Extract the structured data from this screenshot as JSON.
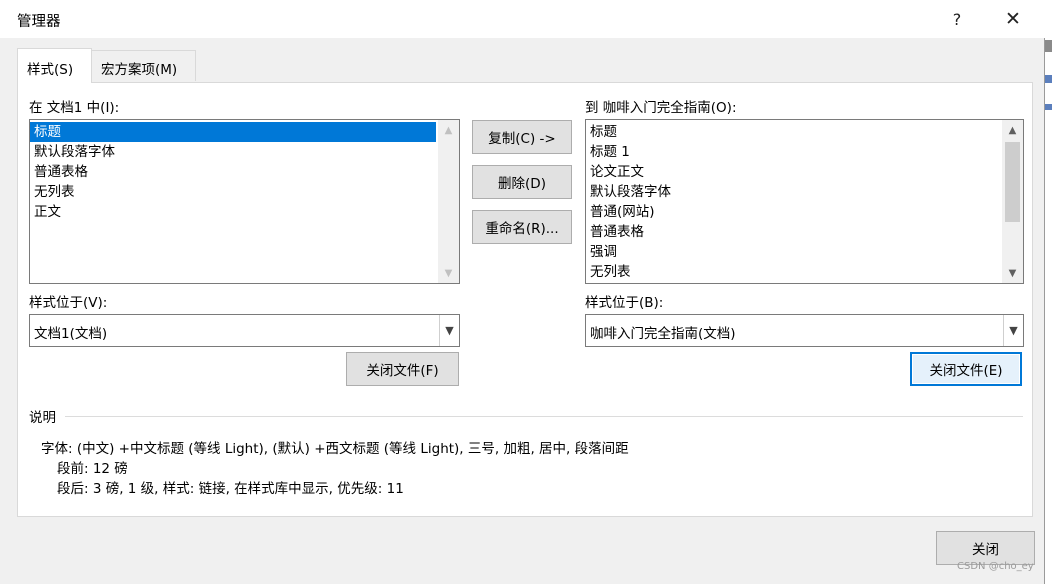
{
  "window": {
    "title": "管理器",
    "help_label": "?",
    "close_label": "✕"
  },
  "tabs": [
    {
      "label": "样式(S)",
      "active": true
    },
    {
      "label": "宏方案项(M)",
      "active": false
    }
  ],
  "left": {
    "label": "在 文档1 中(I):",
    "items": [
      "标题",
      "默认段落字体",
      "普通表格",
      "无列表",
      "正文"
    ],
    "selected_index": 0,
    "location_label": "样式位于(V):",
    "location_value": "文档1(文档)",
    "close_file_label": "关闭文件(F)"
  },
  "actions": {
    "copy_label": "复制(C) ->",
    "delete_label": "删除(D)",
    "rename_label": "重命名(R)..."
  },
  "right": {
    "label": "到 咖啡入门完全指南(O):",
    "items": [
      "标题",
      "标题 1",
      "论文正文",
      "默认段落字体",
      "普通(网站)",
      "普通表格",
      "强调",
      "无列表"
    ],
    "location_label": "样式位于(B):",
    "location_value": "咖啡入门完全指南(文档)",
    "close_file_label": "关闭文件(E)"
  },
  "description": {
    "header": "说明",
    "lines": [
      "字体: (中文) +中文标题 (等线 Light), (默认) +西文标题 (等线 Light), 三号, 加粗, 居中, 段落间距",
      "段前: 12 磅",
      "段后: 3 磅, 1 级, 样式: 链接, 在样式库中显示, 优先级: 11"
    ]
  },
  "footer": {
    "close_label": "关闭"
  },
  "watermark": "CSDN @cho_ey",
  "icons": {
    "up": "chevron-up-icon",
    "down": "chevron-down-icon"
  },
  "colors": {
    "selection": "#0078d7",
    "focus_border": "#0078d7"
  }
}
